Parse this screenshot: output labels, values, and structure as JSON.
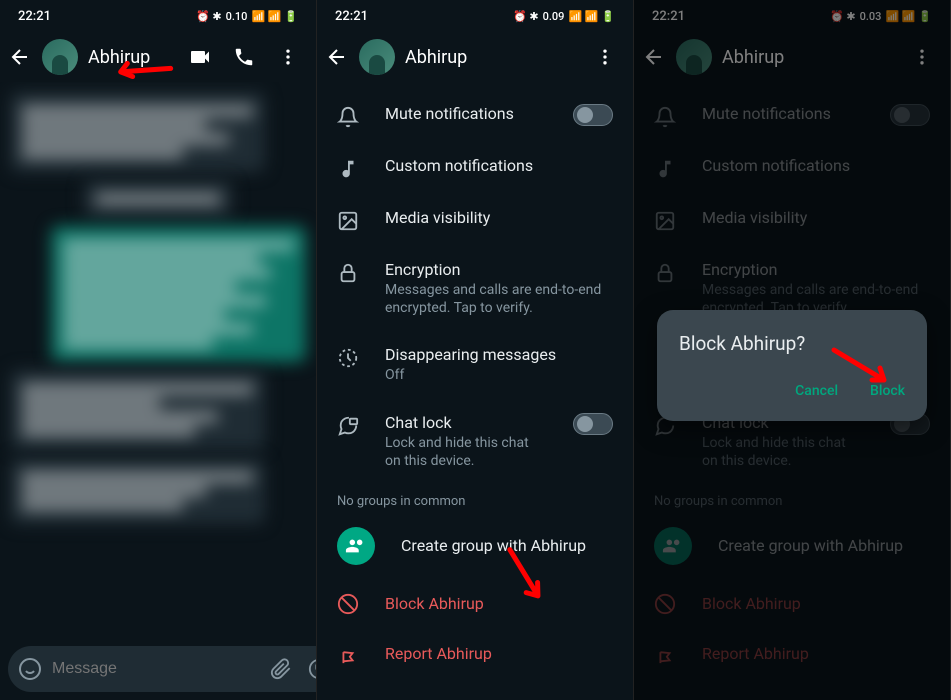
{
  "status": {
    "time": "22:21",
    "kbps1": "0.10",
    "kbps2": "0.09",
    "kbps3": "0.03",
    "battery": "30"
  },
  "contact": {
    "name": "Abhirup"
  },
  "input": {
    "placeholder": "Message"
  },
  "settings": {
    "mute": {
      "title": "Mute notifications"
    },
    "custom": {
      "title": "Custom notifications"
    },
    "media": {
      "title": "Media visibility"
    },
    "encryption": {
      "title": "Encryption",
      "sub": "Messages and calls are end-to-end encrypted. Tap to verify."
    },
    "disappearing": {
      "title": "Disappearing messages",
      "sub": "Off"
    },
    "chatlock": {
      "title": "Chat lock",
      "sub": "Lock and hide this chat on this device."
    },
    "groups_label": "No groups in common",
    "create_group": "Create group with Abhirup",
    "block": "Block Abhirup",
    "report": "Report Abhirup"
  },
  "dialog": {
    "title": "Block Abhirup?",
    "cancel": "Cancel",
    "block": "Block"
  }
}
